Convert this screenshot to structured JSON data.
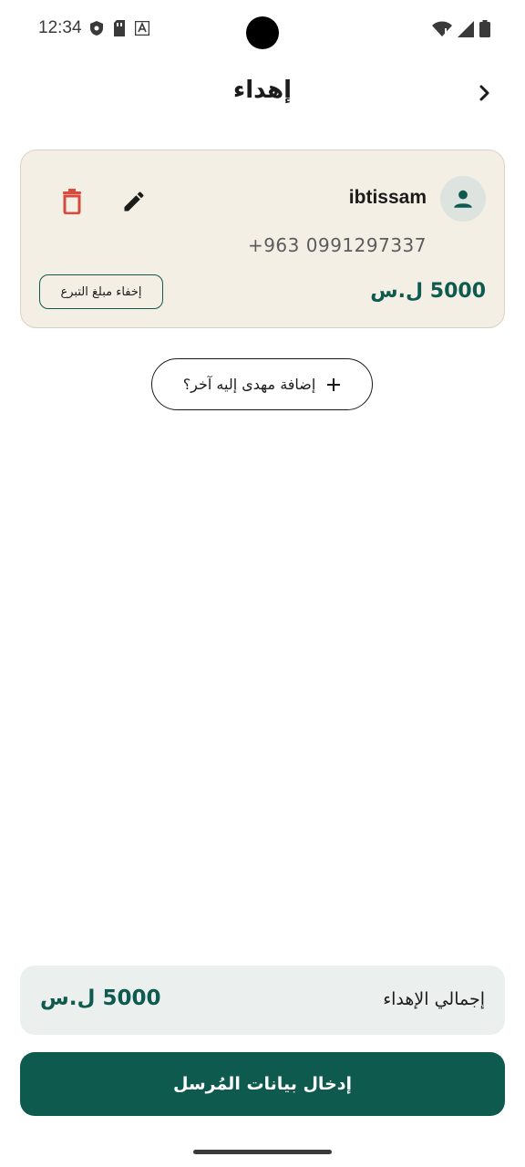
{
  "status_bar": {
    "time": "12:34",
    "left_icons": [
      "shield-icon",
      "sim-card-icon",
      "text-a-icon"
    ],
    "right_icons": [
      "wifi-icon",
      "signal-icon",
      "battery-icon"
    ]
  },
  "header": {
    "title": "إهداء",
    "back_icon": "chevron-right-icon"
  },
  "recipient": {
    "name": "ibtissam",
    "phone": "+963 0991297337",
    "amount": "5000 ل.س",
    "hide_amount_label": "إخفاء مبلغ التبرع",
    "avatar_icon": "person-icon",
    "edit_icon": "pencil-icon",
    "delete_icon": "trash-icon"
  },
  "add_recipient": {
    "label": "إضافة مهدى إليه آخر؟",
    "icon": "plus-icon"
  },
  "total": {
    "label": "إجمالي الإهداء",
    "amount": "5000 ل.س"
  },
  "submit": {
    "label": "إدخال بيانات المُرسل"
  },
  "colors": {
    "brand_green": "#0f5a4f",
    "card_bg": "#f4efe4",
    "total_bg": "#ebf0ee",
    "delete_red": "#d94a3c"
  }
}
